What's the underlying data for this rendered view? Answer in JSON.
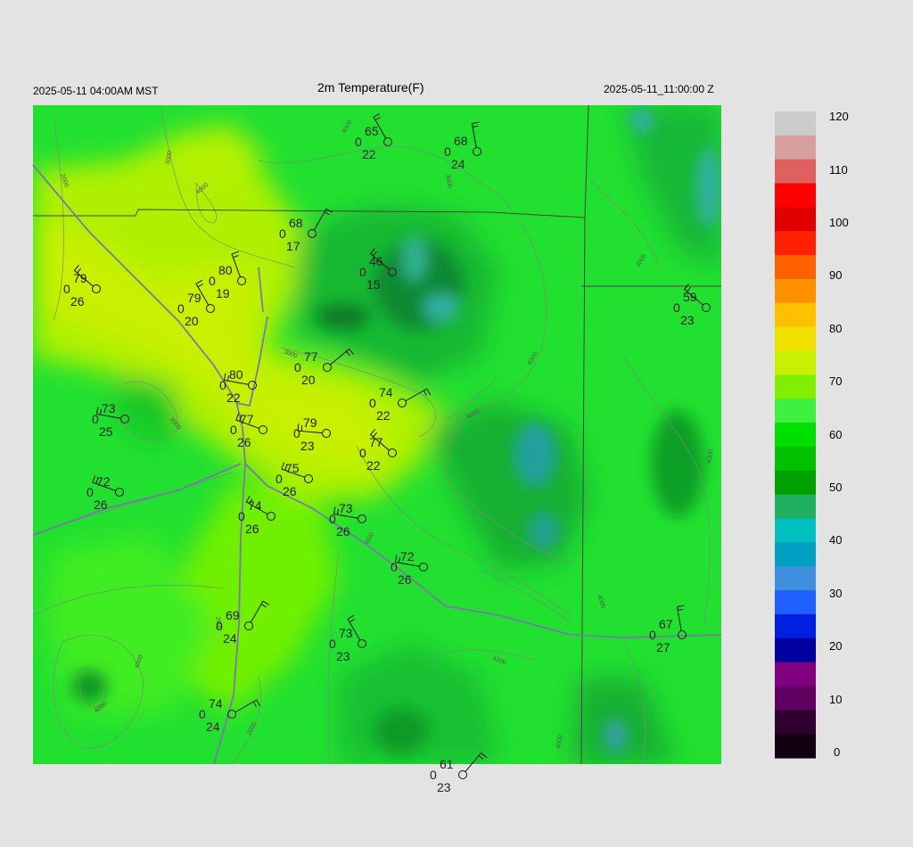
{
  "header": {
    "local_time": "2025-05-11 04:00AM MST",
    "title": "2m Temperature(F)",
    "utc_time": "2025-05-11_11:00:00 Z"
  },
  "colorbar": {
    "ticks": [
      "120",
      "110",
      "100",
      "90",
      "80",
      "70",
      "60",
      "50",
      "40",
      "30",
      "20",
      "10",
      "0"
    ],
    "colors": [
      "#cccccc",
      "#d6a0a0",
      "#e06060",
      "#ff0000",
      "#e00000",
      "#ff2000",
      "#ff6000",
      "#ff9000",
      "#ffc000",
      "#f0e000",
      "#c8f000",
      "#80f000",
      "#40f040",
      "#00e000",
      "#00c000",
      "#00a000",
      "#20b060",
      "#00c0c0",
      "#00a0c0",
      "#4090e0",
      "#2060ff",
      "#0020e0",
      "#0000a0",
      "#800080",
      "#600060",
      "#300030",
      "#100010"
    ]
  },
  "contour_labels": [
    "2000",
    "3000",
    "4000",
    "2000",
    "3000",
    "4000",
    "4000",
    "4000",
    "3000",
    "4000",
    "4000",
    "4000",
    "2000",
    "3000",
    "4000",
    "4000",
    "4000",
    "4000",
    "4000"
  ],
  "stations": [
    {
      "temp": "65",
      "dew": "22",
      "vis": "0"
    },
    {
      "temp": "68",
      "dew": "24",
      "vis": "0"
    },
    {
      "temp": "68",
      "dew": "17",
      "vis": "0"
    },
    {
      "temp": "46",
      "dew": "15",
      "vis": "0"
    },
    {
      "temp": "79",
      "dew": "26",
      "vis": "0"
    },
    {
      "temp": "80",
      "dew": "19",
      "vis": "0"
    },
    {
      "temp": "79",
      "dew": "20",
      "vis": "0"
    },
    {
      "temp": "59",
      "dew": "23",
      "vis": "0"
    },
    {
      "temp": "77",
      "dew": "20",
      "vis": "0"
    },
    {
      "temp": "80",
      "dew": "22",
      "vis": "0"
    },
    {
      "temp": "74",
      "dew": "22",
      "vis": "0"
    },
    {
      "temp": "73",
      "dew": "25",
      "vis": "0"
    },
    {
      "temp": "77",
      "dew": "26",
      "vis": "0"
    },
    {
      "temp": "79",
      "dew": "23",
      "vis": "0"
    },
    {
      "temp": "77",
      "dew": "22",
      "vis": "0"
    },
    {
      "temp": "75",
      "dew": "26",
      "vis": "0"
    },
    {
      "temp": "72",
      "dew": "26",
      "vis": "0"
    },
    {
      "temp": "74",
      "dew": "26",
      "vis": "0"
    },
    {
      "temp": "73",
      "dew": "26",
      "vis": "0"
    },
    {
      "temp": "72",
      "dew": "26",
      "vis": "0"
    },
    {
      "temp": "69",
      "dew": "24",
      "vis": "0"
    },
    {
      "temp": "73",
      "dew": "23",
      "vis": "0"
    },
    {
      "temp": "67",
      "dew": "27",
      "vis": "0"
    },
    {
      "temp": "74",
      "dew": "24",
      "vis": "0"
    },
    {
      "temp": "61",
      "dew": "23",
      "vis": "0"
    }
  ]
}
